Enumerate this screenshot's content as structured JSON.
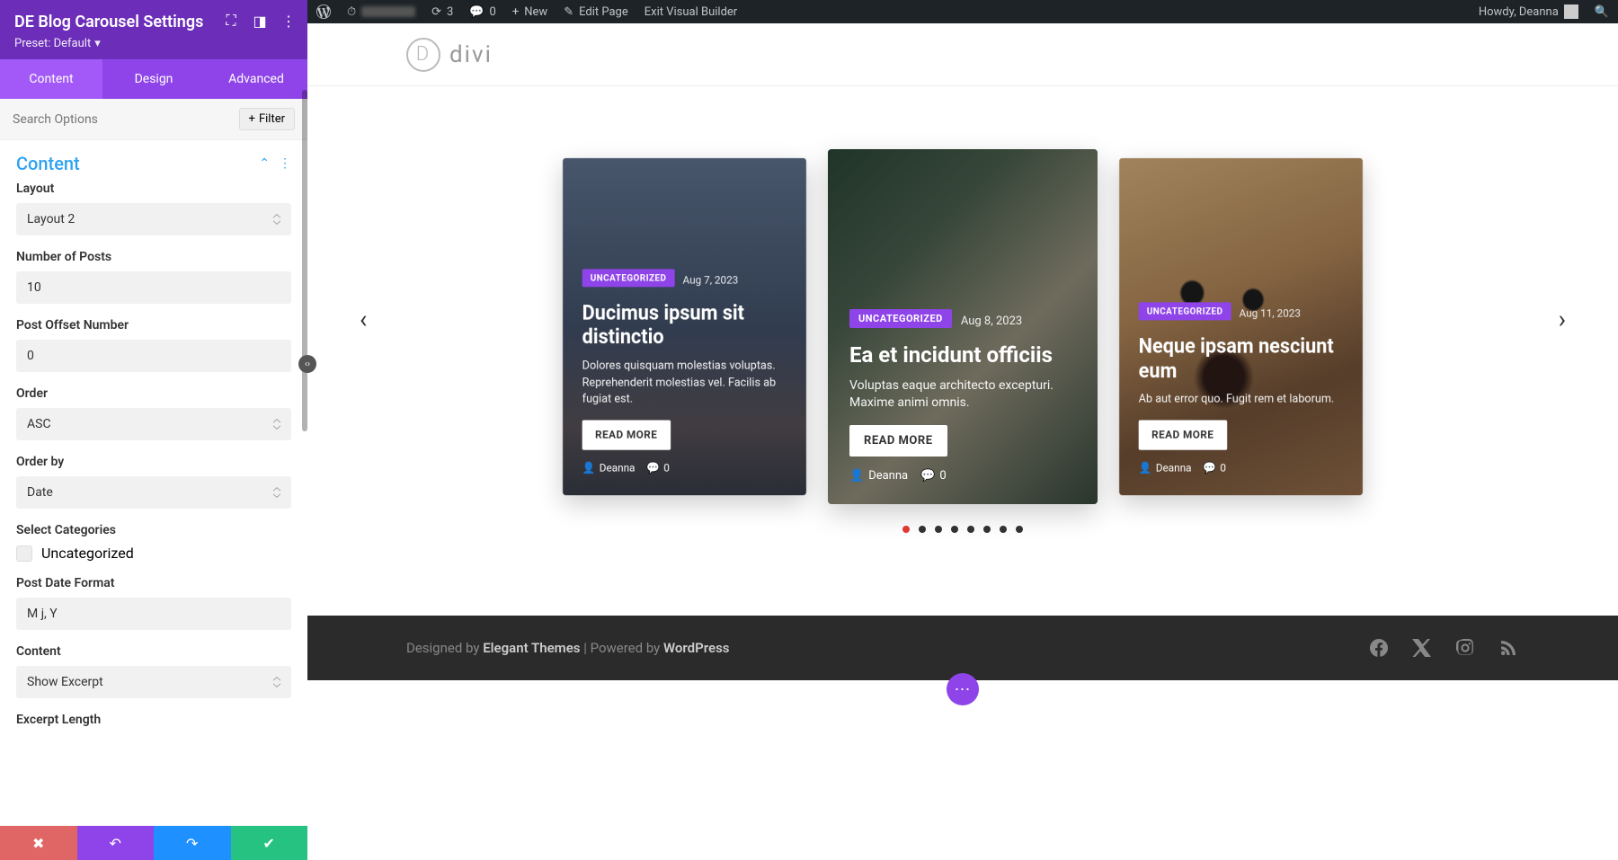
{
  "adminBar": {
    "refresh_count": "3",
    "comments_count": "0",
    "new_label": "New",
    "edit_page_label": "Edit Page",
    "exit_vb_label": "Exit Visual Builder",
    "howdy_label": "Howdy, Deanna"
  },
  "sidebar": {
    "title": "DE Blog Carousel Settings",
    "preset_label": "Preset: Default",
    "tabs": {
      "content": "Content",
      "design": "Design",
      "advanced": "Advanced"
    },
    "search_placeholder": "Search Options",
    "filter_label": "Filter",
    "section_title": "Content",
    "fields": {
      "layout_label": "Layout",
      "layout_value": "Layout 2",
      "num_posts_label": "Number of Posts",
      "num_posts_value": "10",
      "offset_label": "Post Offset Number",
      "offset_value": "0",
      "order_label": "Order",
      "order_value": "ASC",
      "orderby_label": "Order by",
      "orderby_value": "Date",
      "categories_label": "Select Categories",
      "category_option": "Uncategorized",
      "dateformat_label": "Post Date Format",
      "dateformat_value": "M j, Y",
      "content_label": "Content",
      "content_value": "Show Excerpt",
      "excerpt_len_label": "Excerpt Length"
    }
  },
  "diviLogo": "divi",
  "cards": [
    {
      "category": "UNCATEGORIZED",
      "date": "Aug 7, 2023",
      "title": "Ducimus ipsum sit distinctio",
      "excerpt": "Dolores quisquam molestias voluptas. Reprehenderit molestias vel. Facilis ab fugiat est.",
      "read_more": "READ MORE",
      "author": "Deanna",
      "comments": "0"
    },
    {
      "category": "UNCATEGORIZED",
      "date": "Aug 8, 2023",
      "title": "Ea et incidunt officiis",
      "excerpt": "Voluptas eaque architecto excepturi. Maxime animi omnis.",
      "read_more": "READ MORE",
      "author": "Deanna",
      "comments": "0"
    },
    {
      "category": "UNCATEGORIZED",
      "date": "Aug 11, 2023",
      "title": "Neque ipsam nesciunt eum",
      "excerpt": "Ab aut error quo. Fugit rem et laborum.",
      "read_more": "READ MORE",
      "author": "Deanna",
      "comments": "0"
    }
  ],
  "dots_total": 8,
  "dots_active": 0,
  "footer": {
    "designed_by": "Designed by ",
    "elegant": "Elegant Themes",
    "powered_by": " | Powered by ",
    "wordpress": "WordPress"
  }
}
